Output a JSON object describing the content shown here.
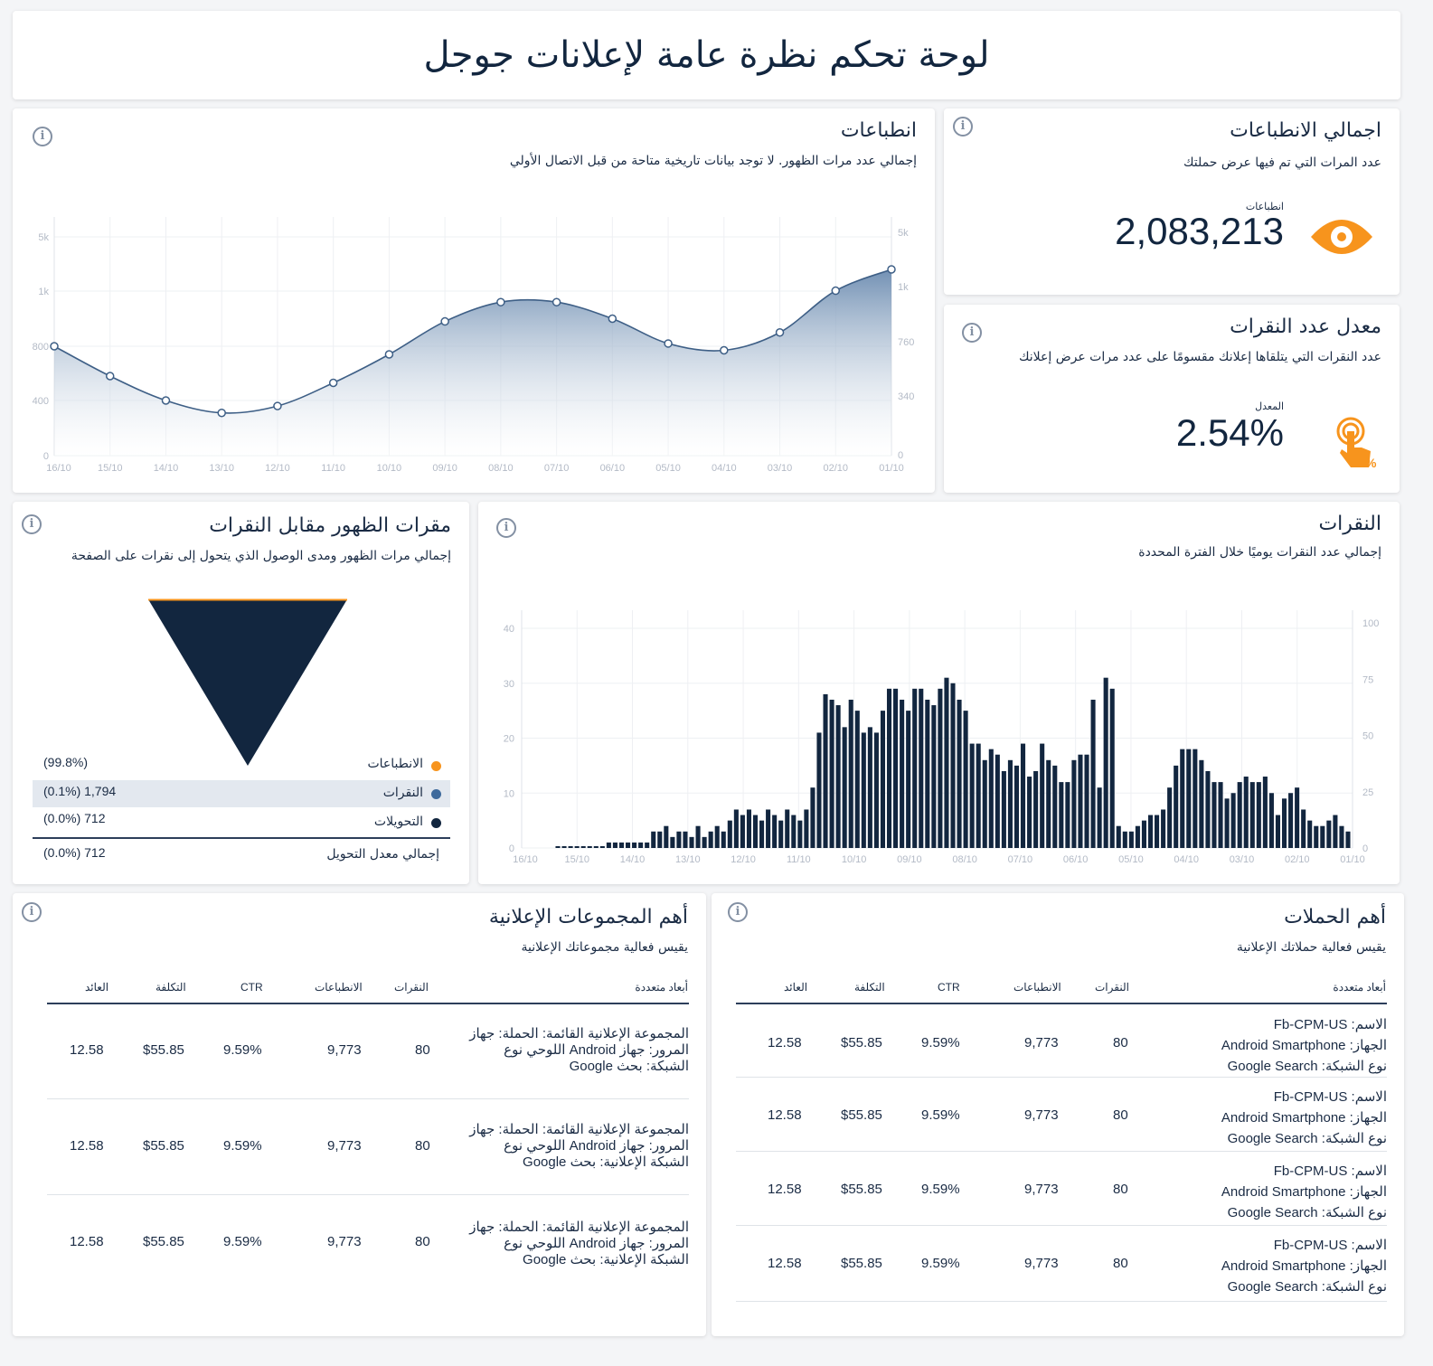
{
  "header": {
    "title": "لوحة تحكم نظرة عامة لإعلانات جوجل"
  },
  "impressions_chart": {
    "title": "انطباعات",
    "subtitle": "إجمالي عدد مرات الظهور. لا توجد بيانات تاريخية متاحة من قبل الاتصال الأولي",
    "info": "i"
  },
  "total_impressions": {
    "title": "اجمالي الانطباعات",
    "subtitle": "عدد المرات التي تم فيها عرض حملتك",
    "label": "انطباعات",
    "value": "2,083,213",
    "icon": "eye-icon",
    "info": "i"
  },
  "ctr_card": {
    "title": "معدل عدد النقرات",
    "subtitle": "عدد النقرات التي يتلقاها إعلانك مقسومًا على عدد مرات عرض إعلانك",
    "label": "المعدل",
    "value": "2.54%",
    "icon": "tap-percent-icon",
    "info": "i"
  },
  "funnel": {
    "title": "مقرات الظهور مقابل النقرات",
    "subtitle": "إجمالي مرات الظهور ومدى الوصول الذي يتحول إلى نقرات على الصفحة",
    "info": "i",
    "rows": [
      {
        "label": "الانطباعات",
        "value": "(99.8%)",
        "color": "#f7941d"
      },
      {
        "label": "النقرات",
        "value": "(0.1%) 1,794",
        "color": "#3e6a9c"
      },
      {
        "label": "التحويلات",
        "value": "(0.0%) 712",
        "color": "#12263f"
      }
    ],
    "total_label": "إجمالي معدل التحويل",
    "total_value": "(0.0%) 712"
  },
  "clicks_chart": {
    "title": "النقرات",
    "subtitle": "إجمالي عدد النقرات يوميًا خلال الفترة المحددة",
    "info": "i"
  },
  "ad_groups": {
    "title": "أهم المجموعات الإعلانية",
    "subtitle": "يقيس فعالية مجموعاتك الإعلانية",
    "info": "i",
    "headers": [
      "أبعاد متعددة",
      "النقرات",
      "الانطباعات",
      "CTR",
      "التكلفة",
      "العائد"
    ],
    "rows": [
      {
        "dims": [
          "المجموعة الإعلانية القائمة: الحملة: جهاز",
          "المرور: جهاز Android اللوحي نوع",
          "الشبكة: بحث Google"
        ],
        "clicks": "80",
        "impressions": "9,773",
        "ctr": "9.59%",
        "cost": "$55.85",
        "revenue": "12.58"
      },
      {
        "dims": [
          "المجموعة الإعلانية القائمة: الحملة: جهاز",
          "المرور: جهاز Android اللوحي نوع",
          "الشبكة الإعلانية: بحث Google"
        ],
        "clicks": "80",
        "impressions": "9,773",
        "ctr": "9.59%",
        "cost": "$55.85",
        "revenue": "12.58"
      },
      {
        "dims": [
          "المجموعة الإعلانية القائمة: الحملة: جهاز",
          "المرور: جهاز Android اللوحي نوع",
          "الشبكة الإعلانية: بحث Google"
        ],
        "clicks": "80",
        "impressions": "9,773",
        "ctr": "9.59%",
        "cost": "$55.85",
        "revenue": "12.58"
      }
    ]
  },
  "campaigns": {
    "title": "أهم الحملات",
    "subtitle": "يقيس فعالية حملاتك الإعلانية",
    "info": "i",
    "headers": [
      "أبعاد متعددة",
      "النقرات",
      "الانطباعات",
      "CTR",
      "التكلفة",
      "العائد"
    ],
    "rows": [
      {
        "dims": [
          "الاسم: Fb-CPM-US",
          "الجهاز: Android Smartphone",
          "نوع الشبكة: Google Search"
        ],
        "clicks": "80",
        "impressions": "9,773",
        "ctr": "9.59%",
        "cost": "$55.85",
        "revenue": "12.58"
      },
      {
        "dims": [
          "الاسم: Fb-CPM-US",
          "الجهاز: Android Smartphone",
          "نوع الشبكة: Google Search"
        ],
        "clicks": "80",
        "impressions": "9,773",
        "ctr": "9.59%",
        "cost": "$55.85",
        "revenue": "12.58"
      },
      {
        "dims": [
          "الاسم: Fb-CPM-US",
          "الجهاز: Android Smartphone",
          "نوع الشبكة: Google Search"
        ],
        "clicks": "80",
        "impressions": "9,773",
        "ctr": "9.59%",
        "cost": "$55.85",
        "revenue": "12.58"
      },
      {
        "dims": [
          "الاسم: Fb-CPM-US",
          "الجهاز: Android Smartphone",
          "نوع الشبكة: Google Search"
        ],
        "clicks": "80",
        "impressions": "9,773",
        "ctr": "9.59%",
        "cost": "$55.85",
        "revenue": "12.58"
      }
    ]
  },
  "chart_data": [
    {
      "type": "area",
      "dates": [
        "16/10",
        "15/10",
        "14/10",
        "13/10",
        "12/10",
        "11/10",
        "10/10",
        "09/10",
        "08/10",
        "07/10",
        "06/10",
        "05/10",
        "04/10",
        "03/10",
        "02/10",
        "01/10"
      ],
      "values": [
        800,
        580,
        400,
        310,
        360,
        530,
        740,
        890,
        960,
        960,
        900,
        810,
        770,
        850,
        1030,
        2600
      ],
      "y_ticks_left": [
        "0",
        "400",
        "800",
        "1k",
        "5k"
      ],
      "y_ticks_right": [
        "0",
        "340",
        "760",
        "1k",
        "5k"
      ],
      "color": "#3e5f86"
    },
    {
      "type": "bar",
      "x_ticks": [
        "16/10",
        "15/10",
        "14/10",
        "13/10",
        "12/10",
        "11/10",
        "10/10",
        "09/10",
        "08/10",
        "07/10",
        "06/10",
        "05/10",
        "04/10",
        "03/10",
        "02/10",
        "01/10"
      ],
      "values": [
        0,
        0,
        0,
        0,
        0,
        0,
        0,
        0,
        1,
        1,
        1,
        1,
        1,
        1,
        1,
        3,
        3,
        4,
        2,
        3,
        3,
        2,
        4,
        2,
        3,
        4,
        3,
        5,
        7,
        6,
        7,
        6,
        5,
        7,
        6,
        5,
        7,
        6,
        5,
        7,
        11,
        21,
        28,
        27,
        26,
        22,
        27,
        25,
        21,
        22,
        21,
        25,
        29,
        29,
        27,
        25,
        29,
        29,
        27,
        26,
        29,
        31,
        30,
        27,
        25,
        19,
        19,
        16,
        18,
        17,
        14,
        16,
        15,
        19,
        13,
        14,
        19,
        16,
        15,
        12,
        12,
        16,
        17,
        17,
        27,
        11,
        31,
        29,
        4,
        3,
        3,
        4,
        5,
        6,
        6,
        7,
        11,
        15,
        18,
        18,
        18,
        16,
        14,
        12,
        12,
        9,
        10,
        12,
        13,
        12,
        12,
        13,
        10,
        6,
        9,
        10,
        11,
        7,
        5,
        4,
        4,
        5,
        6,
        4,
        3
      ],
      "y_ticks_left": [
        "0",
        "10",
        "20",
        "30",
        "40"
      ],
      "y_ticks_right": [
        "0",
        "25",
        "50",
        "75",
        "100"
      ],
      "ylim": [
        0,
        40
      ],
      "color": "#12263f"
    }
  ]
}
